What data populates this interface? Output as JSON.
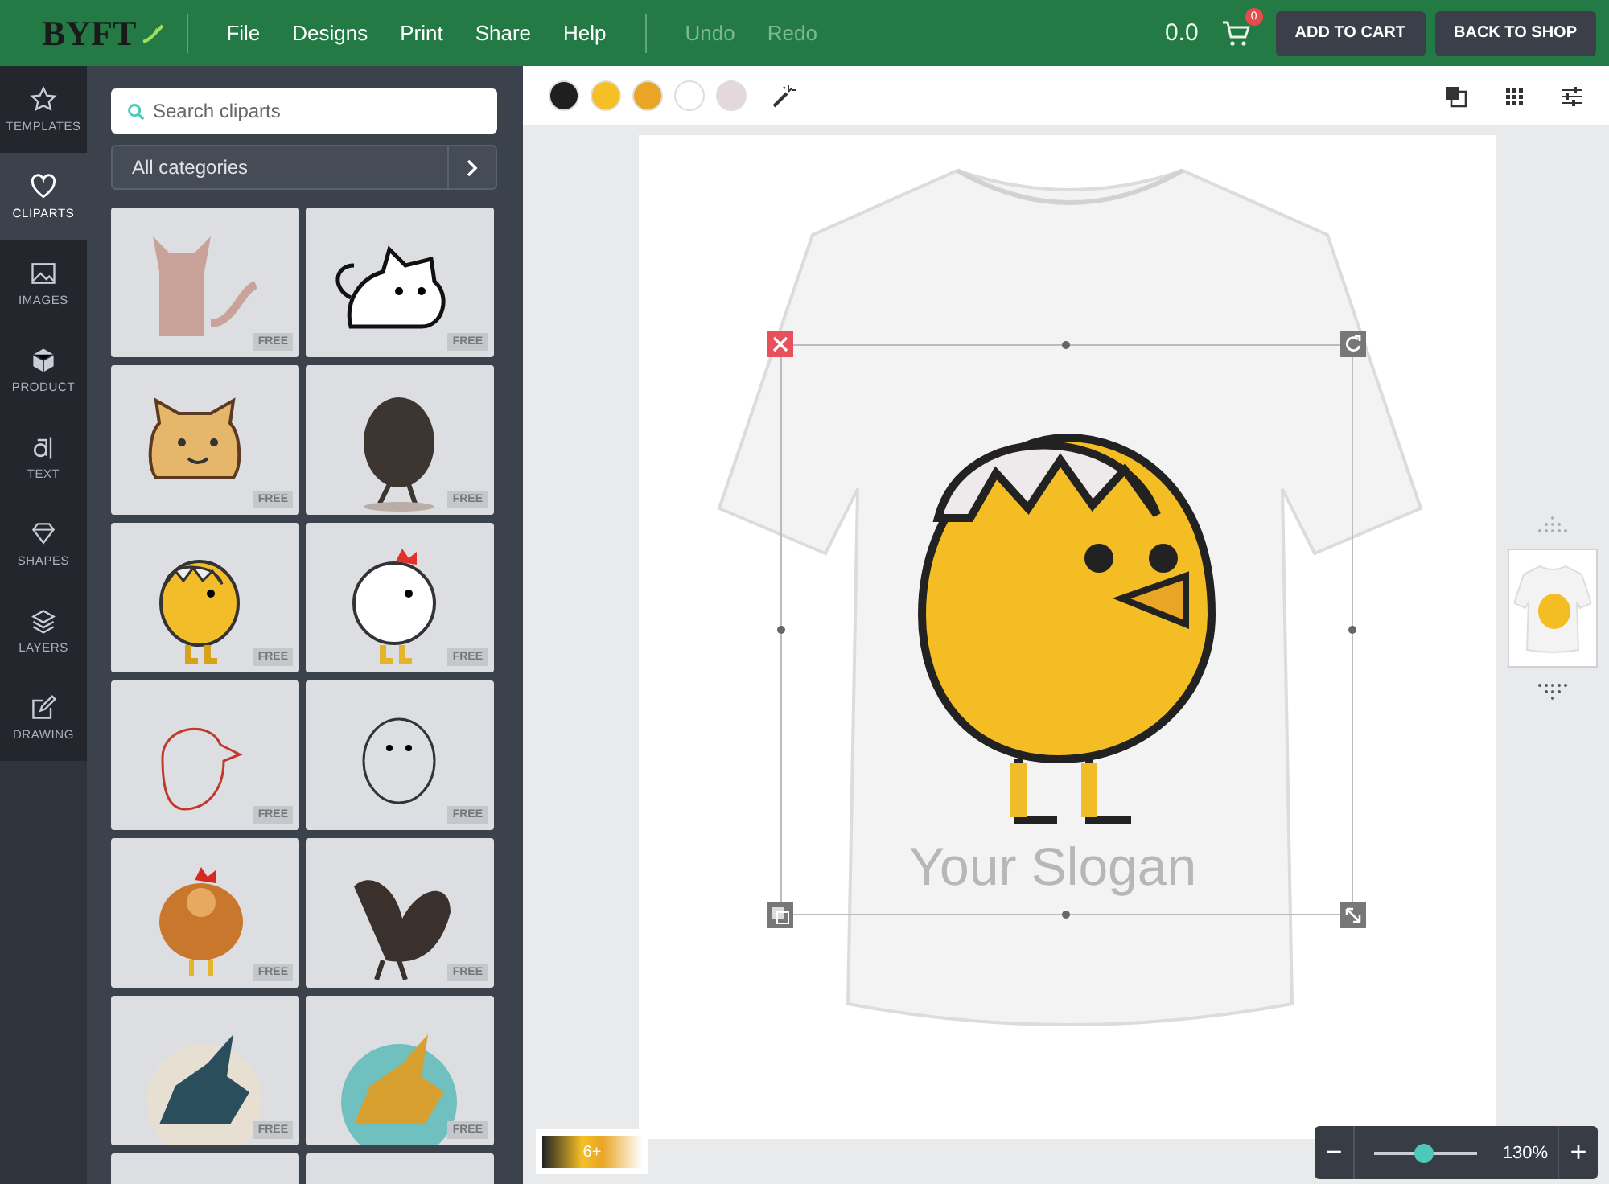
{
  "topbar": {
    "logo": "BYFT",
    "menu": [
      {
        "label": "File",
        "disabled": false
      },
      {
        "label": "Designs",
        "disabled": false
      },
      {
        "label": "Print",
        "disabled": false
      },
      {
        "label": "Share",
        "disabled": false
      },
      {
        "label": "Help",
        "disabled": false
      },
      {
        "label": "Undo",
        "disabled": true
      },
      {
        "label": "Redo",
        "disabled": true
      }
    ],
    "total": "0.0",
    "cart_count": "0",
    "buttons": [
      "ADD TO CART",
      "BACK TO SHOP"
    ]
  },
  "rail": [
    {
      "label": "TEMPLATES",
      "kind": "star",
      "selected": false
    },
    {
      "label": "CLIPARTS",
      "kind": "heart",
      "selected": true
    },
    {
      "label": "IMAGES",
      "kind": "image",
      "selected": false
    },
    {
      "label": "PRODUCT",
      "kind": "cube",
      "selected": false
    },
    {
      "label": "TEXT",
      "kind": "text",
      "selected": false
    },
    {
      "label": "SHAPES",
      "kind": "diamond",
      "selected": false
    },
    {
      "label": "LAYERS",
      "kind": "layers",
      "selected": false
    },
    {
      "label": "DRAWING",
      "kind": "pencil",
      "selected": false
    }
  ],
  "panel": {
    "search": {
      "placeholder": "Search cliparts"
    },
    "category": "All categories",
    "cliparts": [
      {
        "kind": "cat-sitting",
        "badge": "FREE"
      },
      {
        "kind": "cat-lying",
        "badge": "FREE"
      },
      {
        "kind": "cat-face",
        "badge": "FREE"
      },
      {
        "kind": "chick-dark",
        "badge": "FREE"
      },
      {
        "kind": "chick-egg",
        "badge": "FREE"
      },
      {
        "kind": "hen",
        "badge": "FREE"
      },
      {
        "kind": "bird-outline",
        "badge": "FREE"
      },
      {
        "kind": "bird-sketch",
        "badge": "FREE"
      },
      {
        "kind": "chicken",
        "badge": "FREE"
      },
      {
        "kind": "rooster",
        "badge": "FREE"
      },
      {
        "kind": "griffin",
        "badge": "FREE"
      },
      {
        "kind": "griffin-teal",
        "badge": "FREE"
      },
      {
        "kind": "blank"
      },
      {
        "kind": "blank"
      }
    ]
  },
  "toolbar": {
    "colors": [
      {
        "color": "#1f1f1f"
      },
      {
        "color": "#f4c026"
      },
      {
        "color": "#e8a526"
      },
      {
        "color": "#ffffff"
      },
      {
        "color": "#e4d8dd"
      }
    ]
  },
  "design": {
    "slogan": "Your Slogan"
  },
  "views": [
    {
      "selected": true
    }
  ],
  "color_chip": "6+",
  "zoom": {
    "out": "−",
    "level": 0.48,
    "reading": "130%",
    "in": "+"
  }
}
